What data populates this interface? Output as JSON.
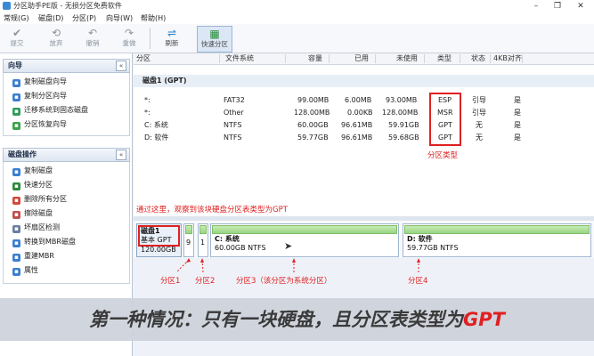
{
  "window": {
    "title": "分区助手PE版 - 无损分区免费软件",
    "minimize": "–",
    "maximize": "❐",
    "close": "✕"
  },
  "menu": {
    "items": [
      "常规(G)",
      "磁盘(D)",
      "分区(P)",
      "向导(W)",
      "帮助(H)"
    ]
  },
  "toolbar": {
    "commit": "提交",
    "discard": "放弃",
    "undo": "撤销",
    "redo": "重做",
    "refresh": "刷新",
    "quick_partition": "快速分区"
  },
  "wizard_panel": {
    "title": "向导",
    "collapse": "«",
    "items": [
      "复制磁盘向导",
      "复制分区向导",
      "迁移系统到固态磁盘",
      "分区恢复向导"
    ]
  },
  "disk_ops_panel": {
    "title": "磁盘操作",
    "collapse": "«",
    "items": [
      "复制磁盘",
      "快速分区",
      "删除所有分区",
      "擦除磁盘",
      "坏扇区检测",
      "转换到MBR磁盘",
      "重建MBR",
      "属性"
    ]
  },
  "table": {
    "headers": [
      "分区",
      "文件系统",
      "容量",
      "已用",
      "未使用",
      "类型",
      "状态",
      "4KB对齐"
    ],
    "disk_label": "磁盘1 (GPT)",
    "rows": [
      [
        "*:",
        "FAT32",
        "99.00MB",
        "6.00MB",
        "93.00MB",
        "ESP",
        "引导",
        "是"
      ],
      [
        "*:",
        "Other",
        "128.00MB",
        "0.00KB",
        "128.00MB",
        "MSR",
        "引导",
        "是"
      ],
      [
        "C: 系统",
        "NTFS",
        "60.00GB",
        "96.61MB",
        "59.91GB",
        "GPT",
        "无",
        "是"
      ],
      [
        "D: 软件",
        "NTFS",
        "59.77GB",
        "96.61MB",
        "59.68GB",
        "GPT",
        "无",
        "是"
      ]
    ]
  },
  "annotations": {
    "partition_type": "分区类型",
    "instruction": "通过这里，观察到该块硬盘分区表类型为GPT",
    "p1": "分区1",
    "p2": "分区2",
    "p3": "分区3（该分区为系统分区）",
    "p4": "分区4"
  },
  "disk_map": {
    "disk_name": "磁盘1",
    "disk_type": "基本 GPT",
    "disk_size": "120.00GB",
    "p1_label": "9",
    "p2_label": "1",
    "c_name": "C: 系统",
    "c_info": "60.00GB NTFS",
    "d_name": "D: 软件",
    "d_info": "59.77GB NTFS"
  },
  "banner": {
    "text_main": "第一种情况：只有一块硬盘，且分区表类型为",
    "text_red": "GPT"
  },
  "colors": {
    "annotation_red": "#e02020",
    "partition_bar_green": "#9ad483",
    "selection_blue": "#dbe7f5"
  }
}
